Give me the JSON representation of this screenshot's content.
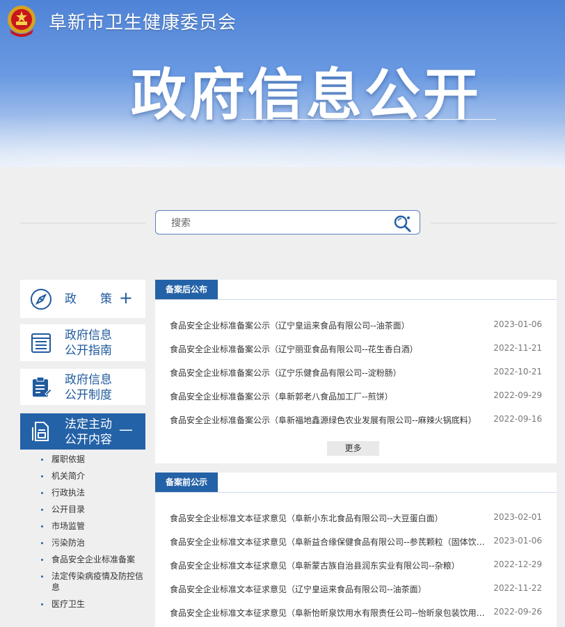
{
  "header": {
    "org_name": "阜新市卫生健康委员会",
    "title": "政府信息公开"
  },
  "search": {
    "placeholder": "搜索"
  },
  "sidebar": {
    "items": [
      {
        "label": "政　　策",
        "sign": "+",
        "icon": "compass-icon"
      },
      {
        "label_line1": "政府信息",
        "label_line2": "公开指南",
        "icon": "list-icon"
      },
      {
        "label_line1": "政府信息",
        "label_line2": "公开制度",
        "icon": "clipboard-icon"
      },
      {
        "label_line1": "法定主动",
        "label_line2": "公开内容",
        "sign": "—",
        "icon": "document-icon",
        "active": true
      }
    ],
    "sub_items": [
      "履职依据",
      "机关简介",
      "行政执法",
      "公开目录",
      "市场监管",
      "污染防治",
      "食品安全企业标准备案",
      "法定传染病疫情及防控信息",
      "医疗卫生"
    ]
  },
  "panel1": {
    "tab": "备案后公布",
    "more": "更多",
    "rows": [
      {
        "title": "食品安全企业标准备案公示（辽宁皇运来食品有限公司--油茶面）",
        "date": "2023-01-06"
      },
      {
        "title": "食品安全企业标准备案公示（辽宁丽亚食品有限公司--花生香白酒）",
        "date": "2022-11-21"
      },
      {
        "title": "食品安全企业标准备案公示（辽宁乐健食品有限公司--淀粉肠）",
        "date": "2022-10-21"
      },
      {
        "title": "食品安全企业标准备案公示（阜新郭老八食品加工厂--煎饼）",
        "date": "2022-09-29"
      },
      {
        "title": "食品安全企业标准备案公示（阜新福地鑫源绿色农业发展有限公司--麻辣火锅底料）",
        "date": "2022-09-16"
      }
    ]
  },
  "panel2": {
    "tab": "备案前公示",
    "rows": [
      {
        "title": "食品安全企业标准文本征求意见（阜新小东北食品有限公司--大豆蛋白面）",
        "date": "2023-02-01"
      },
      {
        "title": "食品安全企业标准文本征求意见（阜新益合缘保健食品有限公司--参芪颗粒（固体饮料））",
        "date": "2023-01-06"
      },
      {
        "title": "食品安全企业标准文本征求意见（阜新蒙古族自治县润东实业有限公司--杂粮）",
        "date": "2022-12-29"
      },
      {
        "title": "食品安全企业标准文本征求意见（辽宁皇运来食品有限公司--油茶面）",
        "date": "2022-11-22"
      },
      {
        "title": "食品安全企业标准文本征求意见（阜新怡昕泉饮用水有限责任公司--怡昕泉包装饮用水）",
        "date": "2022-09-26"
      }
    ]
  },
  "colors": {
    "primary": "#2462a7",
    "banner_top": "#4f83d6",
    "background": "#efefef"
  }
}
